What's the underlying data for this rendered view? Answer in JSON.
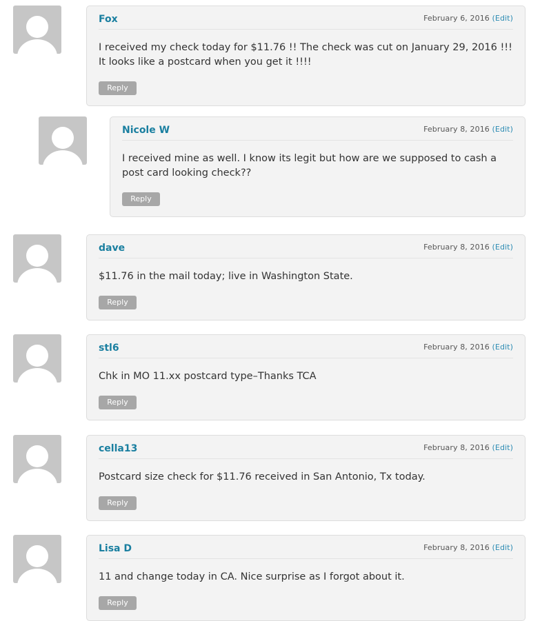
{
  "comments": [
    {
      "author": "Fox",
      "date": "February 6, 2016",
      "edit_label": "(Edit)",
      "text": "I received my check today for $11.76 !! The check was cut on January 29, 2016 !!! It looks like a postcard when you get it !!!!",
      "reply_label": "Reply",
      "avatar_icon": "default-avatar-icon"
    },
    {
      "author": "Nicole W",
      "date": "February 8, 2016",
      "edit_label": "(Edit)",
      "text": "I received mine as well. I know its legit but how are we supposed to cash a post card looking check??",
      "reply_label": "Reply",
      "avatar_icon": "default-avatar-icon"
    },
    {
      "author": "dave",
      "date": "February 8, 2016",
      "edit_label": "(Edit)",
      "text": "$11.76 in the mail today; live in Washington State.",
      "reply_label": "Reply",
      "avatar_icon": "default-avatar-icon"
    },
    {
      "author": "stl6",
      "date": "February 8, 2016",
      "edit_label": "(Edit)",
      "text": "Chk in MO 11.xx postcard type–Thanks TCA",
      "reply_label": "Reply",
      "avatar_icon": "default-avatar-icon"
    },
    {
      "author": "cella13",
      "date": "February 8, 2016",
      "edit_label": "(Edit)",
      "text": "Postcard size check for $11.76 received in San Antonio, Tx today.",
      "reply_label": "Reply",
      "avatar_icon": "default-avatar-icon"
    },
    {
      "author": "Lisa D",
      "date": "February 8, 2016",
      "edit_label": "(Edit)",
      "text": "11 and change today in CA. Nice surprise as I forgot about it.",
      "reply_label": "Reply",
      "avatar_icon": "default-avatar-icon"
    }
  ],
  "colors": {
    "author": "#1a7fa0",
    "edit_link": "#2b8bb3",
    "bubble_bg": "#f3f3f3",
    "reply_button": "#a7a7a7",
    "avatar_bg": "#c6c6c6"
  }
}
